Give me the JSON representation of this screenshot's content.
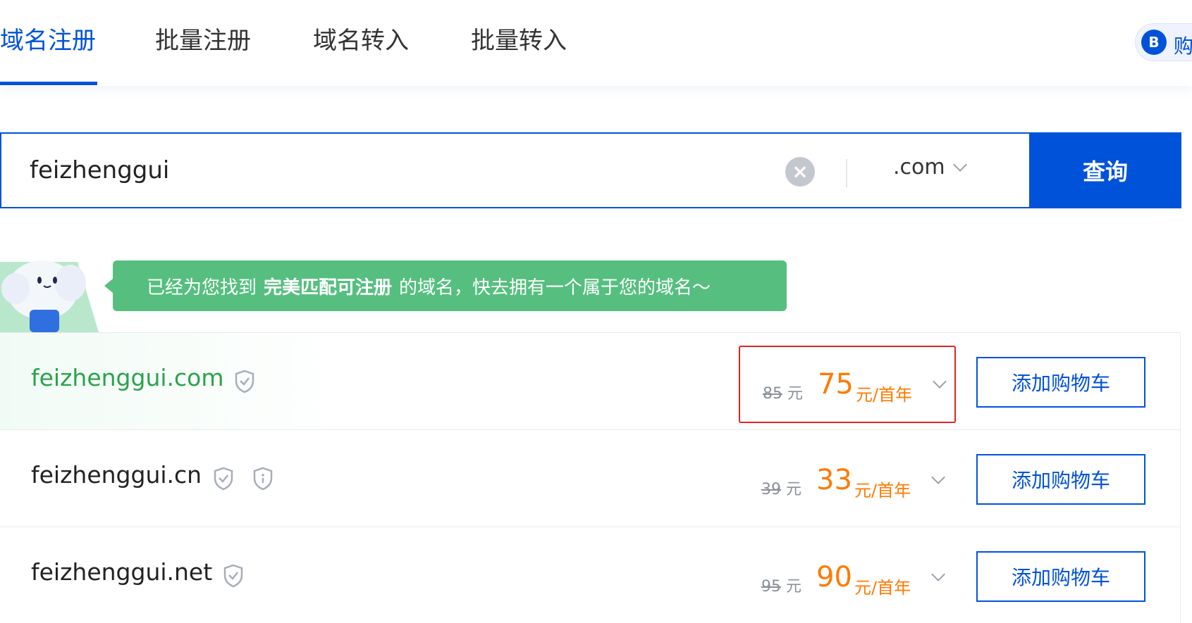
{
  "tabs": [
    {
      "label": "域名注册",
      "active": true
    },
    {
      "label": "批量注册",
      "active": false
    },
    {
      "label": "域名转入",
      "active": false
    },
    {
      "label": "批量转入",
      "active": false
    }
  ],
  "cart_pill": {
    "icon_letter": "B",
    "label": "购"
  },
  "search": {
    "value": "feizhenggui",
    "tld": ".com",
    "button_label": "查询"
  },
  "notice": {
    "prefix": "已经为您找到",
    "highlight": "完美匹配可注册",
    "suffix": "的域名，快去拥有一个属于您的域名～"
  },
  "results": [
    {
      "domain": "feizhenggui.com",
      "old_price": "85",
      "old_unit": "元",
      "price": "75",
      "unit": "元/首年",
      "button": "添加购物车",
      "badges": [
        "shield-check"
      ]
    },
    {
      "domain": "feizhenggui.cn",
      "old_price": "39",
      "old_unit": "元",
      "price": "33",
      "unit": "元/首年",
      "button": "添加购物车",
      "badges": [
        "shield-check",
        "shield-info"
      ]
    },
    {
      "domain": "feizhenggui.net",
      "old_price": "95",
      "old_unit": "元",
      "price": "90",
      "unit": "元/首年",
      "button": "添加购物车",
      "badges": [
        "shield-check"
      ]
    }
  ],
  "colors": {
    "brand": "#0052d9",
    "price": "#ff7a00",
    "success": "#56bf7f",
    "highlight_border": "#e02424"
  }
}
